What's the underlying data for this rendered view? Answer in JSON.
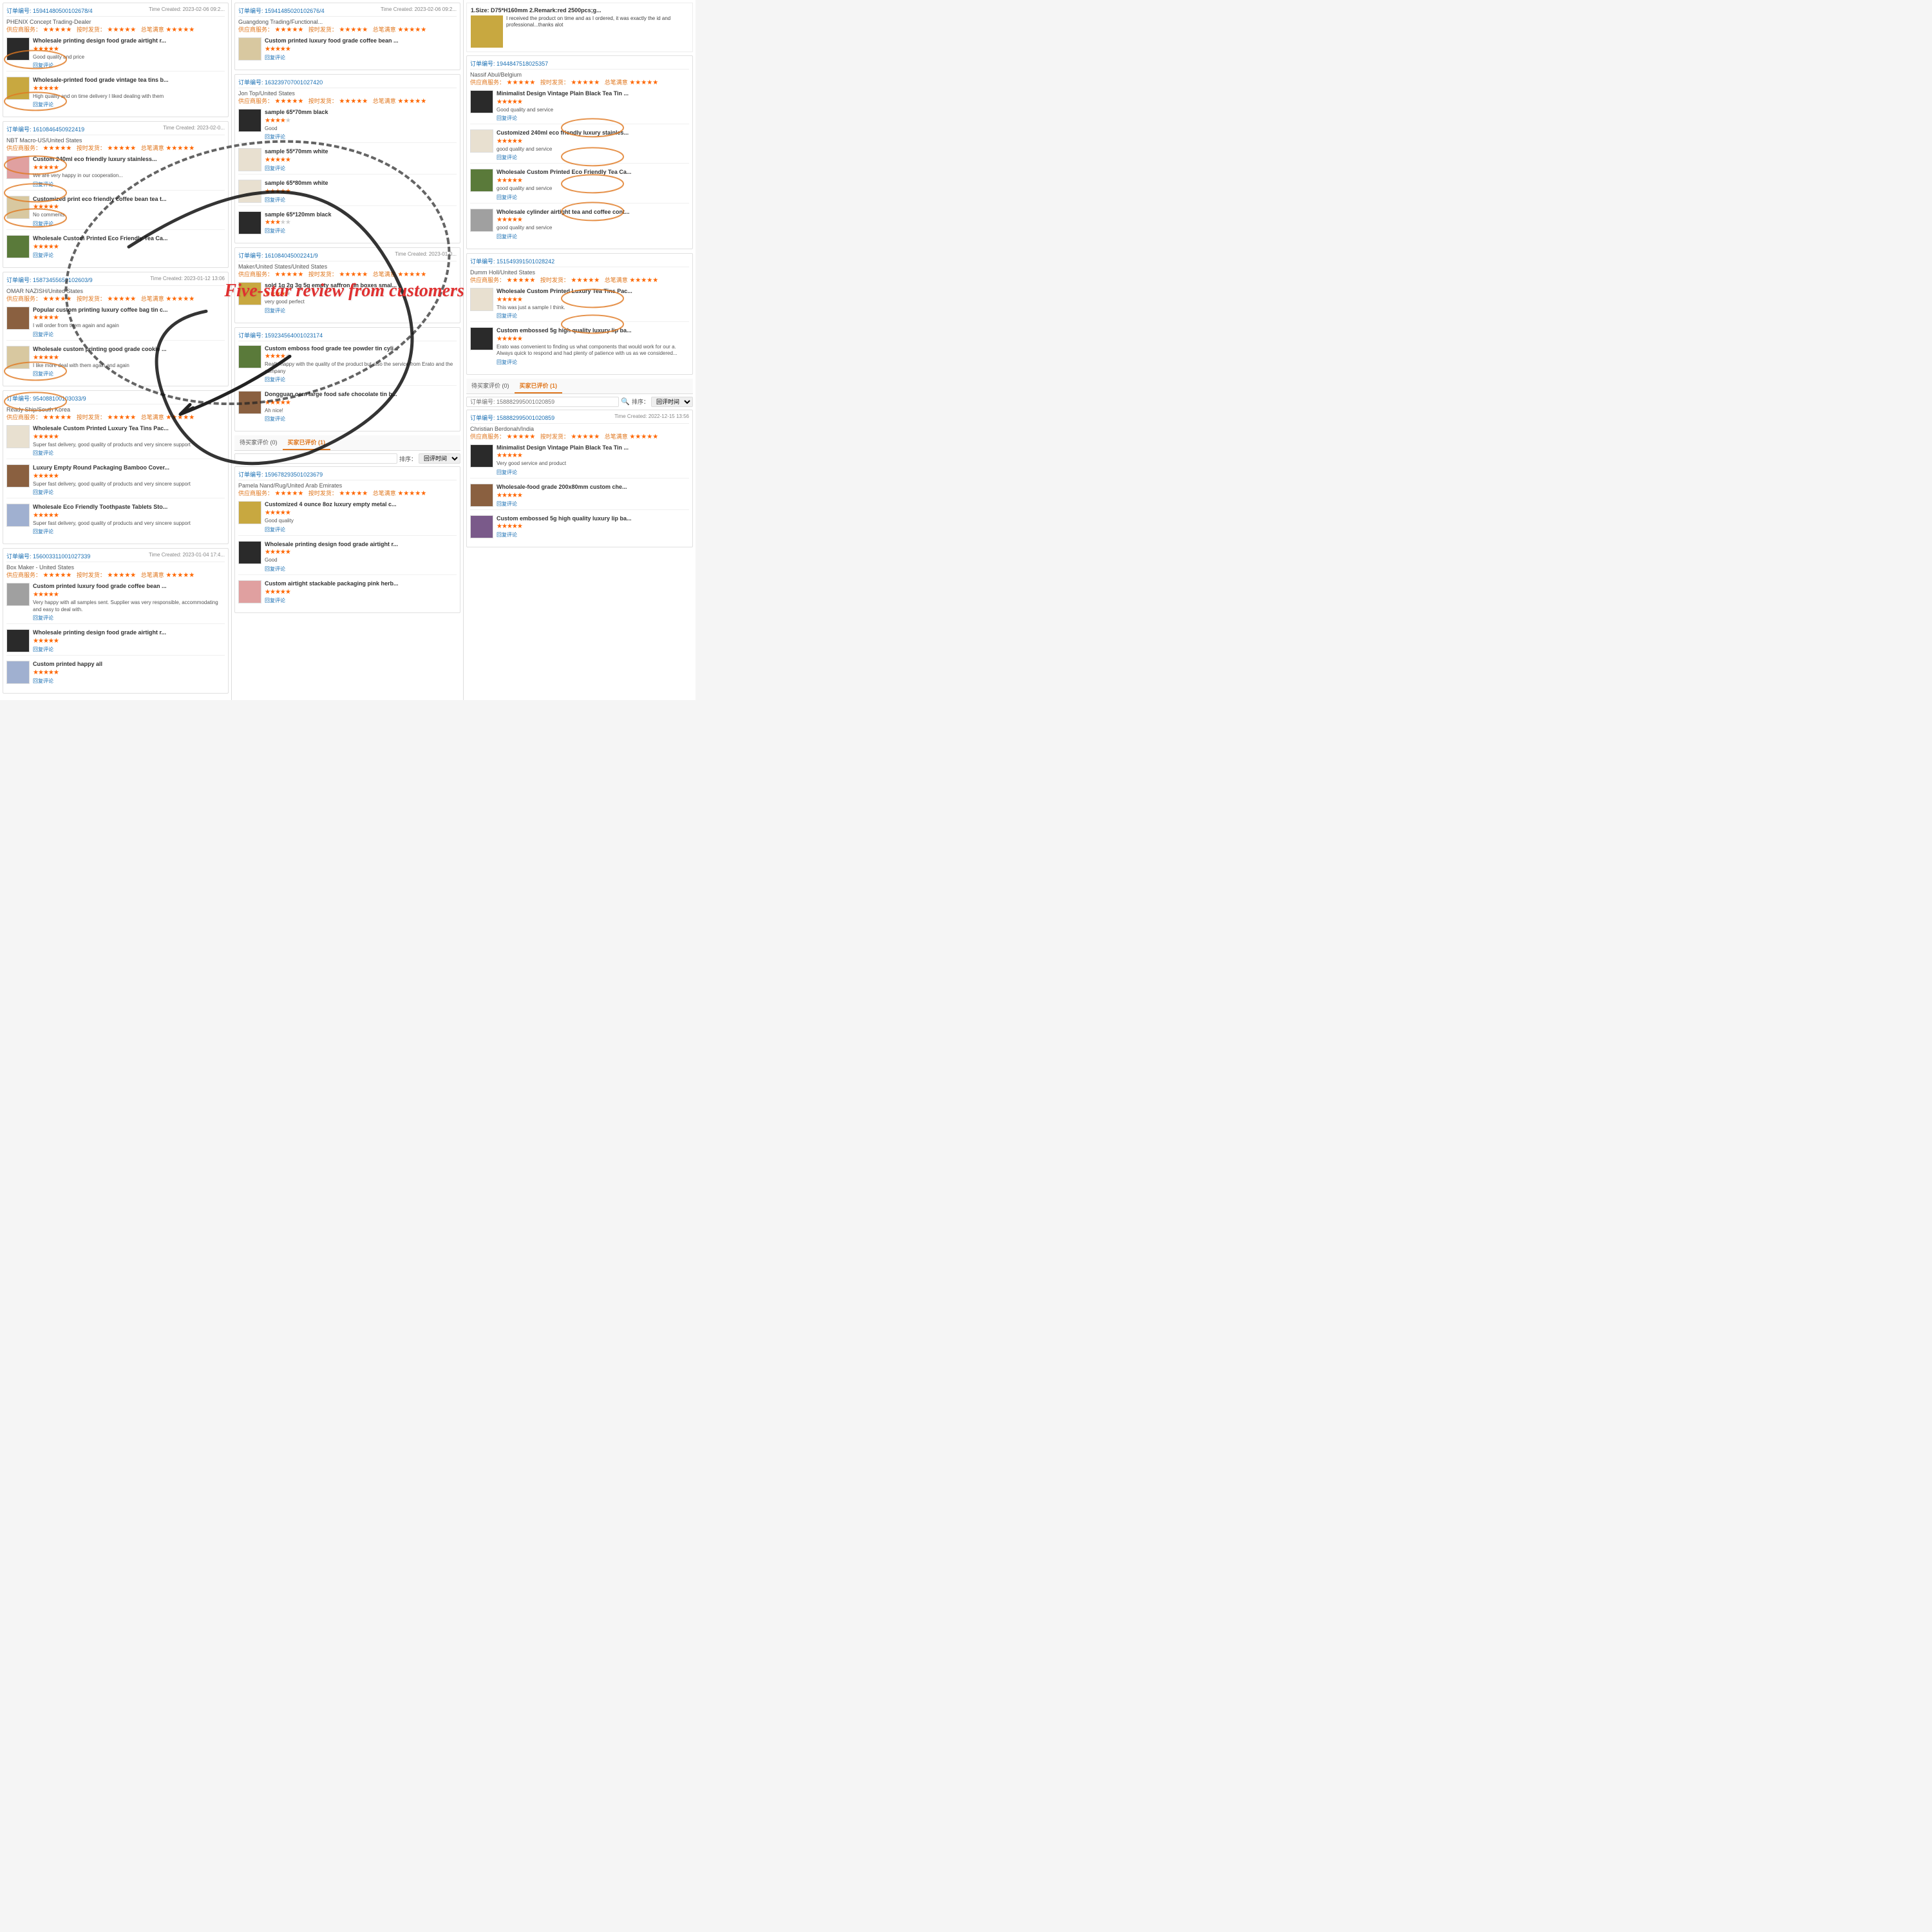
{
  "overlay": {
    "main_text": "Five-star review from  customers"
  },
  "tabs": {
    "pending_label": "待买家评价 (0)",
    "buyer_label": "买家已评价 (1)",
    "active_tab": "buyer"
  },
  "search": {
    "placeholder": "",
    "sort_label": "排序：",
    "sort_option": "回评时间"
  },
  "column1": {
    "orders": [
      {
        "id": "订单编号: 15941480500102678/4",
        "time": "Time Created: 2023-02-06 09:2...",
        "supplier": "PHENIX Concept Trading-Dealer",
        "service_label": "供应商服务：",
        "service_stars": 5,
        "logistics_label": "按时发货：",
        "logistics_stars": 5,
        "satisfaction_label": "总笔满意",
        "satisfaction_stars": 5,
        "reviews": [
          {
            "title": "Wholesale printing design food grade airtight r...",
            "stars": 5,
            "text": "Good quality and price",
            "thumb_class": "thumb-dark",
            "reply_label": "回复评论"
          },
          {
            "title": "Wholesale-printed food grade vintage tea tins b...",
            "stars": 5,
            "text": "High quality and on time delivery I liked dealing with them",
            "thumb_class": "thumb-gold",
            "reply_label": "回复评论"
          }
        ]
      },
      {
        "id": "订单编号: 1610846450922419",
        "time": "Time Created: 2023-02-0...",
        "supplier": "NBT Macro-US/United States",
        "service_label": "供应商服务：",
        "service_stars": 5,
        "logistics_label": "按时发货：",
        "logistics_stars": 5,
        "satisfaction_label": "总笔满意",
        "satisfaction_stars": 5,
        "reviews": [
          {
            "title": "Custom 240ml eco friendly luxury stainless...",
            "stars": 5,
            "text": "We are very happy in our cooperation...",
            "thumb_class": "thumb-pink",
            "reply_label": "回复评论"
          },
          {
            "title": "Customized print eco friendly coffee bean tea t...",
            "stars": 5,
            "text": "No comments",
            "thumb_class": "thumb-beige",
            "reply_label": "回复评论"
          },
          {
            "title": "Wholesale Custom Printed Eco Friendly Tea Ca...",
            "stars": 5,
            "text": "",
            "thumb_class": "thumb-green",
            "reply_label": "回复评论"
          }
        ]
      },
      {
        "id": "订单编号: 15873455650102603/9",
        "time": "Time Created: 2023-01-12 13:06",
        "supplier": "OMAR NAZISH/United States",
        "service_label": "供应商服务：",
        "service_stars": 5,
        "logistics_label": "按时发货：",
        "logistics_stars": 5,
        "satisfaction_label": "总笔满意",
        "satisfaction_stars": 5,
        "reviews": [
          {
            "title": "Popular custom printing luxury coffee bag tin c...",
            "stars": 5,
            "text": "I will order from them again and again",
            "thumb_class": "thumb-brown",
            "reply_label": "回复评论"
          },
          {
            "title": "Wholesale custom printing good grade cookie ...",
            "stars": 5,
            "text": "I like more deal with them again and again",
            "thumb_class": "thumb-beige",
            "reply_label": "回复评论"
          }
        ]
      },
      {
        "id": "订单编号: 954088100103033/9",
        "time": "",
        "supplier": "Ready Ship/South Korea",
        "service_label": "供应商服务：",
        "service_stars": 5,
        "logistics_label": "按时发货：",
        "logistics_stars": 5,
        "satisfaction_label": "总笔满意",
        "satisfaction_stars": 5,
        "reviews": [
          {
            "title": "Wholesale Custom Printed Luxury Tea Tins Pac...",
            "stars": 5,
            "text": "Super fast delivery, good quality of products and very sincere support",
            "thumb_class": "thumb-light",
            "reply_label": "回复评论"
          },
          {
            "title": "Luxury Empty Round Packaging Bamboo Cover...",
            "stars": 5,
            "text": "Super fast delivery, good quality of products and very sincere support",
            "thumb_class": "thumb-brown",
            "reply_label": "回复评论"
          },
          {
            "title": "Wholesale Eco Friendly Toothpaste Tablets Sto...",
            "stars": 5,
            "text": "Super fast delivery, good quality of products and very sincere support",
            "thumb_class": "thumb-blue",
            "reply_label": "回复评论"
          }
        ]
      },
      {
        "id": "订单编号: 156003311001027339",
        "time": "Time Created: 2023-01-04 17:4...",
        "supplier": "Box Maker - United States",
        "service_label": "供应商服务：",
        "service_stars": 5,
        "logistics_label": "按时发货：",
        "logistics_stars": 5,
        "satisfaction_label": "总笔满意",
        "satisfaction_stars": 5,
        "reviews": [
          {
            "title": "Custom printed luxury food grade coffee bean ...",
            "stars": 5,
            "text": "Very happy with all samples sent. Supplier was very responsible, accommodating and easy to deal with.",
            "thumb_class": "thumb-gray",
            "reply_label": "回复评论"
          },
          {
            "title": "Wholesale printing design food grade airtight r...",
            "stars": 5,
            "text": "",
            "thumb_class": "thumb-dark",
            "reply_label": "回复评论"
          },
          {
            "title": "Custom printed happy all",
            "stars": 5,
            "text": "",
            "thumb_class": "thumb-blue",
            "reply_label": "回复评论"
          }
        ]
      }
    ]
  },
  "column2": {
    "orders": [
      {
        "id": "订单编号: 15941485020102676/4",
        "time": "Time Created: 2023-02-06 09:2...",
        "supplier": "Guangdong Trading/Functional...",
        "service_label": "供应商服务：",
        "service_stars": 5,
        "logistics_label": "按时发货：",
        "logistics_stars": 5,
        "satisfaction_label": "总笔满意",
        "satisfaction_stars": 5,
        "reviews": [
          {
            "title": "Custom printed luxury food grade coffee bean ...",
            "stars": 5,
            "text": "",
            "thumb_class": "thumb-beige",
            "reply_label": "回复评论"
          }
        ]
      },
      {
        "id": "订单编号: 163239707001027420",
        "time": "",
        "supplier": "Jon Top/United States",
        "service_label": "供应商服务：",
        "service_stars": 5,
        "logistics_label": "按时发货：",
        "logistics_stars": 5,
        "satisfaction_label": "总笔满意",
        "satisfaction_stars": 5,
        "reviews": [
          {
            "title": "sample 65*70mm black",
            "stars": 4,
            "text": "Good",
            "thumb_class": "thumb-dark",
            "reply_label": "回复评论"
          },
          {
            "title": "sample 55*70mm white",
            "stars": 5,
            "text": "",
            "thumb_class": "thumb-light",
            "reply_label": "回复评论"
          },
          {
            "title": "sample 65*80mm white",
            "stars": 5,
            "text": "",
            "thumb_class": "thumb-light",
            "reply_label": "回复评论"
          },
          {
            "title": "sample 65*120mm black",
            "stars": 3,
            "text": "",
            "thumb_class": "thumb-dark",
            "reply_label": "回复评论"
          }
        ]
      },
      {
        "id": "订单编号: 161084045002241/9",
        "time": "Time Created: 2023-01-0...",
        "supplier": "Maker/United States/United States",
        "service_label": "供应商服务：",
        "service_stars": 5,
        "logistics_label": "按时发货：",
        "logistics_stars": 5,
        "satisfaction_label": "总笔满意",
        "satisfaction_stars": 5,
        "reviews": [
          {
            "title": "sold 1g 2g 3g 5g empty saffron tin boxes smal...",
            "stars": 4,
            "text": "very good perfect",
            "thumb_class": "thumb-gold",
            "reply_label": "回复评论"
          }
        ]
      },
      {
        "id": "订单编号: 159234564001023174",
        "time": "",
        "supplier": "",
        "service_label": "供应商服务：",
        "service_stars": 5,
        "logistics_label": "按时发货：",
        "logistics_stars": 5,
        "satisfaction_label": "总笔满意",
        "satisfaction_stars": 5,
        "reviews": [
          {
            "title": "Custom emboss food grade tee powder tin cyli...",
            "stars": 4,
            "text": "Really happy with the quality of the product but also the service from Erato and the company",
            "thumb_class": "thumb-green",
            "reply_label": "回复评论"
          },
          {
            "title": "Dongguan oem large food safe chocolate tin b...",
            "stars": 5,
            "text": "Ah nice!",
            "thumb_class": "thumb-brown",
            "reply_label": "回复评论"
          }
        ]
      }
    ],
    "tabs_section": {
      "tab1": "待买家评价 (0)",
      "tab2": "买家已评价 (1)"
    },
    "bottom_order": {
      "id": "订单编号: 159678293501023679",
      "time": "",
      "supplier": "Pamela Nand/Rug/United Arab Emirates",
      "service_label": "供应商服务：",
      "service_stars": 5,
      "logistics_label": "按时发货：",
      "logistics_stars": 5,
      "satisfaction_label": "总笔满意",
      "satisfaction_stars": 5,
      "reviews": [
        {
          "title": "Customized 4 ounce 8oz luxury empty metal c...",
          "stars": 5,
          "text": "Good quality",
          "thumb_class": "thumb-gold",
          "reply_label": "回复评论"
        },
        {
          "title": "Wholesale printing design food grade airtight r...",
          "stars": 5,
          "text": "Good",
          "thumb_class": "thumb-dark",
          "reply_label": "回复评论"
        },
        {
          "title": "Custom airtight stackable packaging pink herb...",
          "stars": 5,
          "text": "",
          "thumb_class": "thumb-pink",
          "reply_label": "回复评论"
        }
      ]
    }
  },
  "column3": {
    "hero_text": "1.Size: D75*H160mm 2.Remark:red 2500pcs;g...",
    "hero_review": "I received the product on time and as I ordered, it was exactly the id and professional...thanks alot",
    "orders": [
      {
        "id": "订单编号: 1944847518025357",
        "time": "",
        "supplier": "Nassif Abul/Belgium",
        "service_label": "供应商服务：",
        "service_stars": 5,
        "logistics_label": "按时发货：",
        "logistics_stars": 5,
        "satisfaction_label": "总笔满意",
        "satisfaction_stars": 5,
        "reviews": [
          {
            "title": "Minimalist Design Vintage Plain Black Tea Tin ...",
            "stars": 5,
            "text": "Good quality and service",
            "thumb_class": "thumb-dark",
            "reply_label": "回复评论"
          },
          {
            "title": "Customized 240ml eco friendly luxury stainles...",
            "stars": 5,
            "text": "good quality and service",
            "thumb_class": "thumb-light",
            "reply_label": "回复评论"
          },
          {
            "title": "Wholesale Custom Printed Eco Friendly Tea Ca...",
            "stars": 5,
            "text": "good quality and service",
            "thumb_class": "thumb-green",
            "reply_label": "回复评论"
          },
          {
            "title": "Wholesale cylinder airtight tea and coffee cont...",
            "stars": 5,
            "text": "good quality and service",
            "thumb_class": "thumb-gray",
            "reply_label": "回复评论"
          }
        ]
      },
      {
        "id": "订单编号: 151549391501028242",
        "time": "",
        "supplier": "Dumm Holl/United States",
        "service_label": "供应商服务：",
        "service_stars": 5,
        "logistics_label": "按时发货：",
        "logistics_stars": 5,
        "satisfaction_label": "总笔满意",
        "satisfaction_stars": 5,
        "reviews": [
          {
            "title": "Wholesale Custom Printed Luxury Tea Tins Pac...",
            "stars": 5,
            "text": "This was just a sample I think.",
            "thumb_class": "thumb-light",
            "reply_label": "回复评论"
          },
          {
            "title": "Custom embossed 5g high quality luxury lip ba...",
            "stars": 5,
            "text": "Erato was convenient to finding us what components that would work for our a. Always quick to respond and had plenty of patience with us as we considered...",
            "thumb_class": "thumb-dark",
            "reply_label": "回复评论"
          }
        ]
      }
    ],
    "bottom_order": {
      "id": "订单编号: 158882995001020859",
      "time": "Time Created: 2022-12-15 13:56",
      "supplier": "Christian Berdonah/India",
      "service_label": "供应商服务：",
      "service_stars": 5,
      "logistics_label": "按时发货：",
      "logistics_stars": 5,
      "satisfaction_label": "总笔满意",
      "satisfaction_stars": 5,
      "reviews": [
        {
          "title": "Minimalist Design Vintage Plain Black Tea Tin ...",
          "stars": 5,
          "text": "Very good service and product",
          "thumb_class": "thumb-dark",
          "reply_label": "回复评论"
        },
        {
          "title": "Wholesale-food grade 200x80mm custom che...",
          "stars": 5,
          "text": "",
          "thumb_class": "thumb-brown",
          "reply_label": "回复评论"
        },
        {
          "title": "Custom embossed 5g high quality luxury lip ba...",
          "stars": 5,
          "text": "",
          "thumb_class": "thumb-purple",
          "reply_label": "回复评论"
        }
      ]
    }
  }
}
